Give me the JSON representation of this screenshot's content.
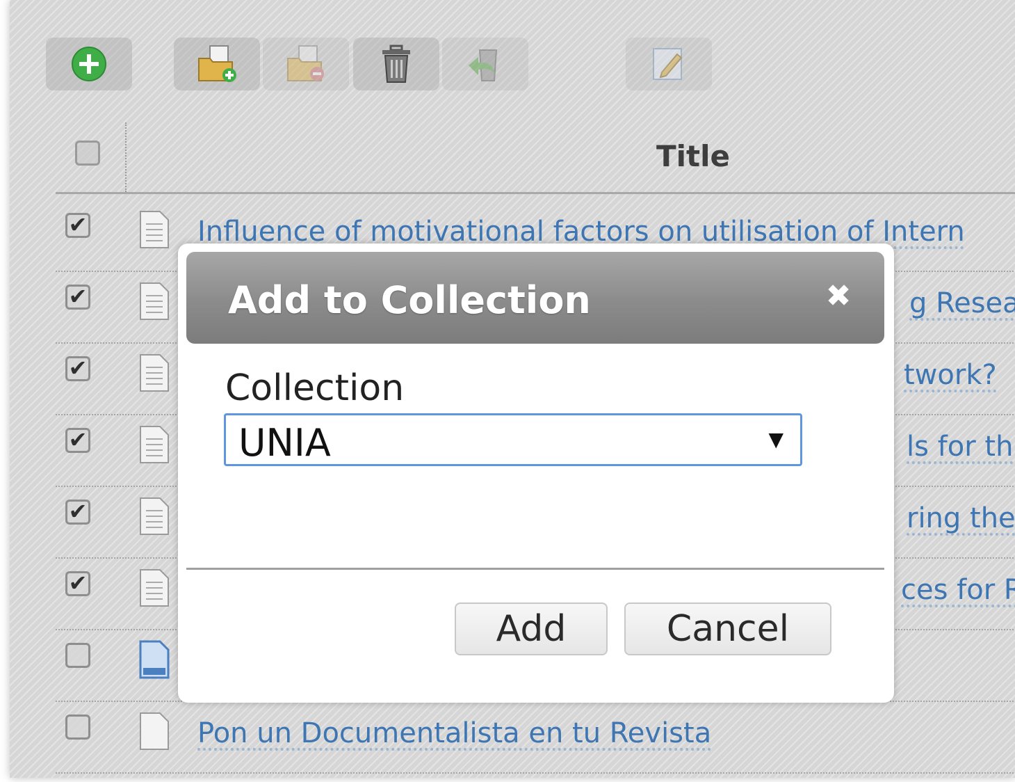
{
  "toolbar": {
    "buttons": [
      {
        "name": "add",
        "icon": "add-circle-icon",
        "enabled": true
      },
      {
        "name": "add-to-collection",
        "icon": "folder-add-icon",
        "enabled": true
      },
      {
        "name": "remove-from-collection",
        "icon": "folder-remove-icon",
        "enabled": false
      },
      {
        "name": "delete",
        "icon": "trash-icon",
        "enabled": true
      },
      {
        "name": "restore",
        "icon": "undo-icon",
        "enabled": false
      },
      {
        "name": "edit",
        "icon": "edit-icon",
        "enabled": false
      }
    ]
  },
  "table": {
    "header_title": "Title",
    "rows": [
      {
        "checked": true,
        "icon": "document-icon",
        "visible_title": "Influence of motivational factors on utilisation of Intern"
      },
      {
        "checked": true,
        "icon": "document-icon",
        "visible_title": "g Resea"
      },
      {
        "checked": true,
        "icon": "document-icon",
        "visible_title": "twork?"
      },
      {
        "checked": true,
        "icon": "document-icon",
        "visible_title": "ls for th"
      },
      {
        "checked": true,
        "icon": "document-icon",
        "visible_title": "ring the"
      },
      {
        "checked": true,
        "icon": "document-icon",
        "visible_title": "ces for R"
      },
      {
        "checked": false,
        "icon": "document-blue-icon",
        "visible_title": ""
      },
      {
        "checked": false,
        "icon": "document-blank-icon",
        "visible_title": "Pon un Documentalista en tu Revista"
      }
    ]
  },
  "dialog": {
    "title": "Add to Collection",
    "close_symbol": "✖",
    "field_label": "Collection",
    "selected_value": "UNIA",
    "caret_symbol": "▼",
    "add_label": "Add",
    "cancel_label": "Cancel"
  },
  "colors": {
    "link": "#3d76b3",
    "header_gradient_top": "#a7a7a7",
    "header_gradient_bottom": "#7c7c7c",
    "select_border": "#5f96de",
    "add_icon_green": "#3fae47"
  }
}
